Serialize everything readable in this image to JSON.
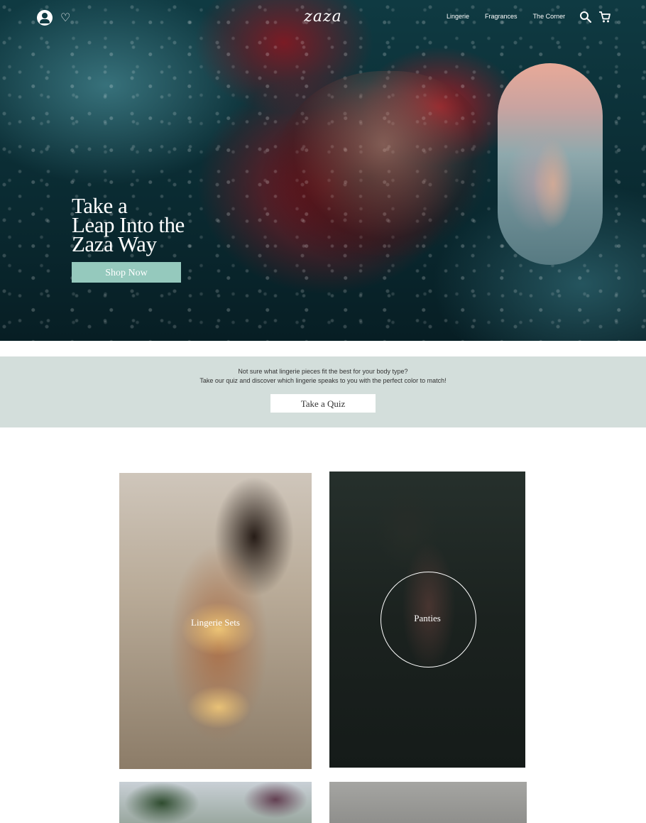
{
  "brand": {
    "logo": "zaza"
  },
  "nav": {
    "links": [
      "Lingerie",
      "Fragrances",
      "The Corner"
    ]
  },
  "hero": {
    "title_lines": [
      "Take a",
      "Leap Into the",
      "Zaza Way"
    ],
    "cta_label": "Shop Now"
  },
  "quiz": {
    "line1": "Not sure what lingerie pieces fit the best for your body type?",
    "line2": "Take our quiz and discover which lingerie speaks to you with the perfect color to match!",
    "button_label": "Take a Quiz"
  },
  "categories": [
    {
      "label": "Lingerie Sets"
    },
    {
      "label": "Panties"
    }
  ],
  "colors": {
    "accent": "#95c9bd",
    "quiz_band": "#d3dedb",
    "hero_water": "#0f3a42"
  },
  "icons": [
    "account-icon",
    "heart-icon",
    "search-icon",
    "cart-icon"
  ]
}
